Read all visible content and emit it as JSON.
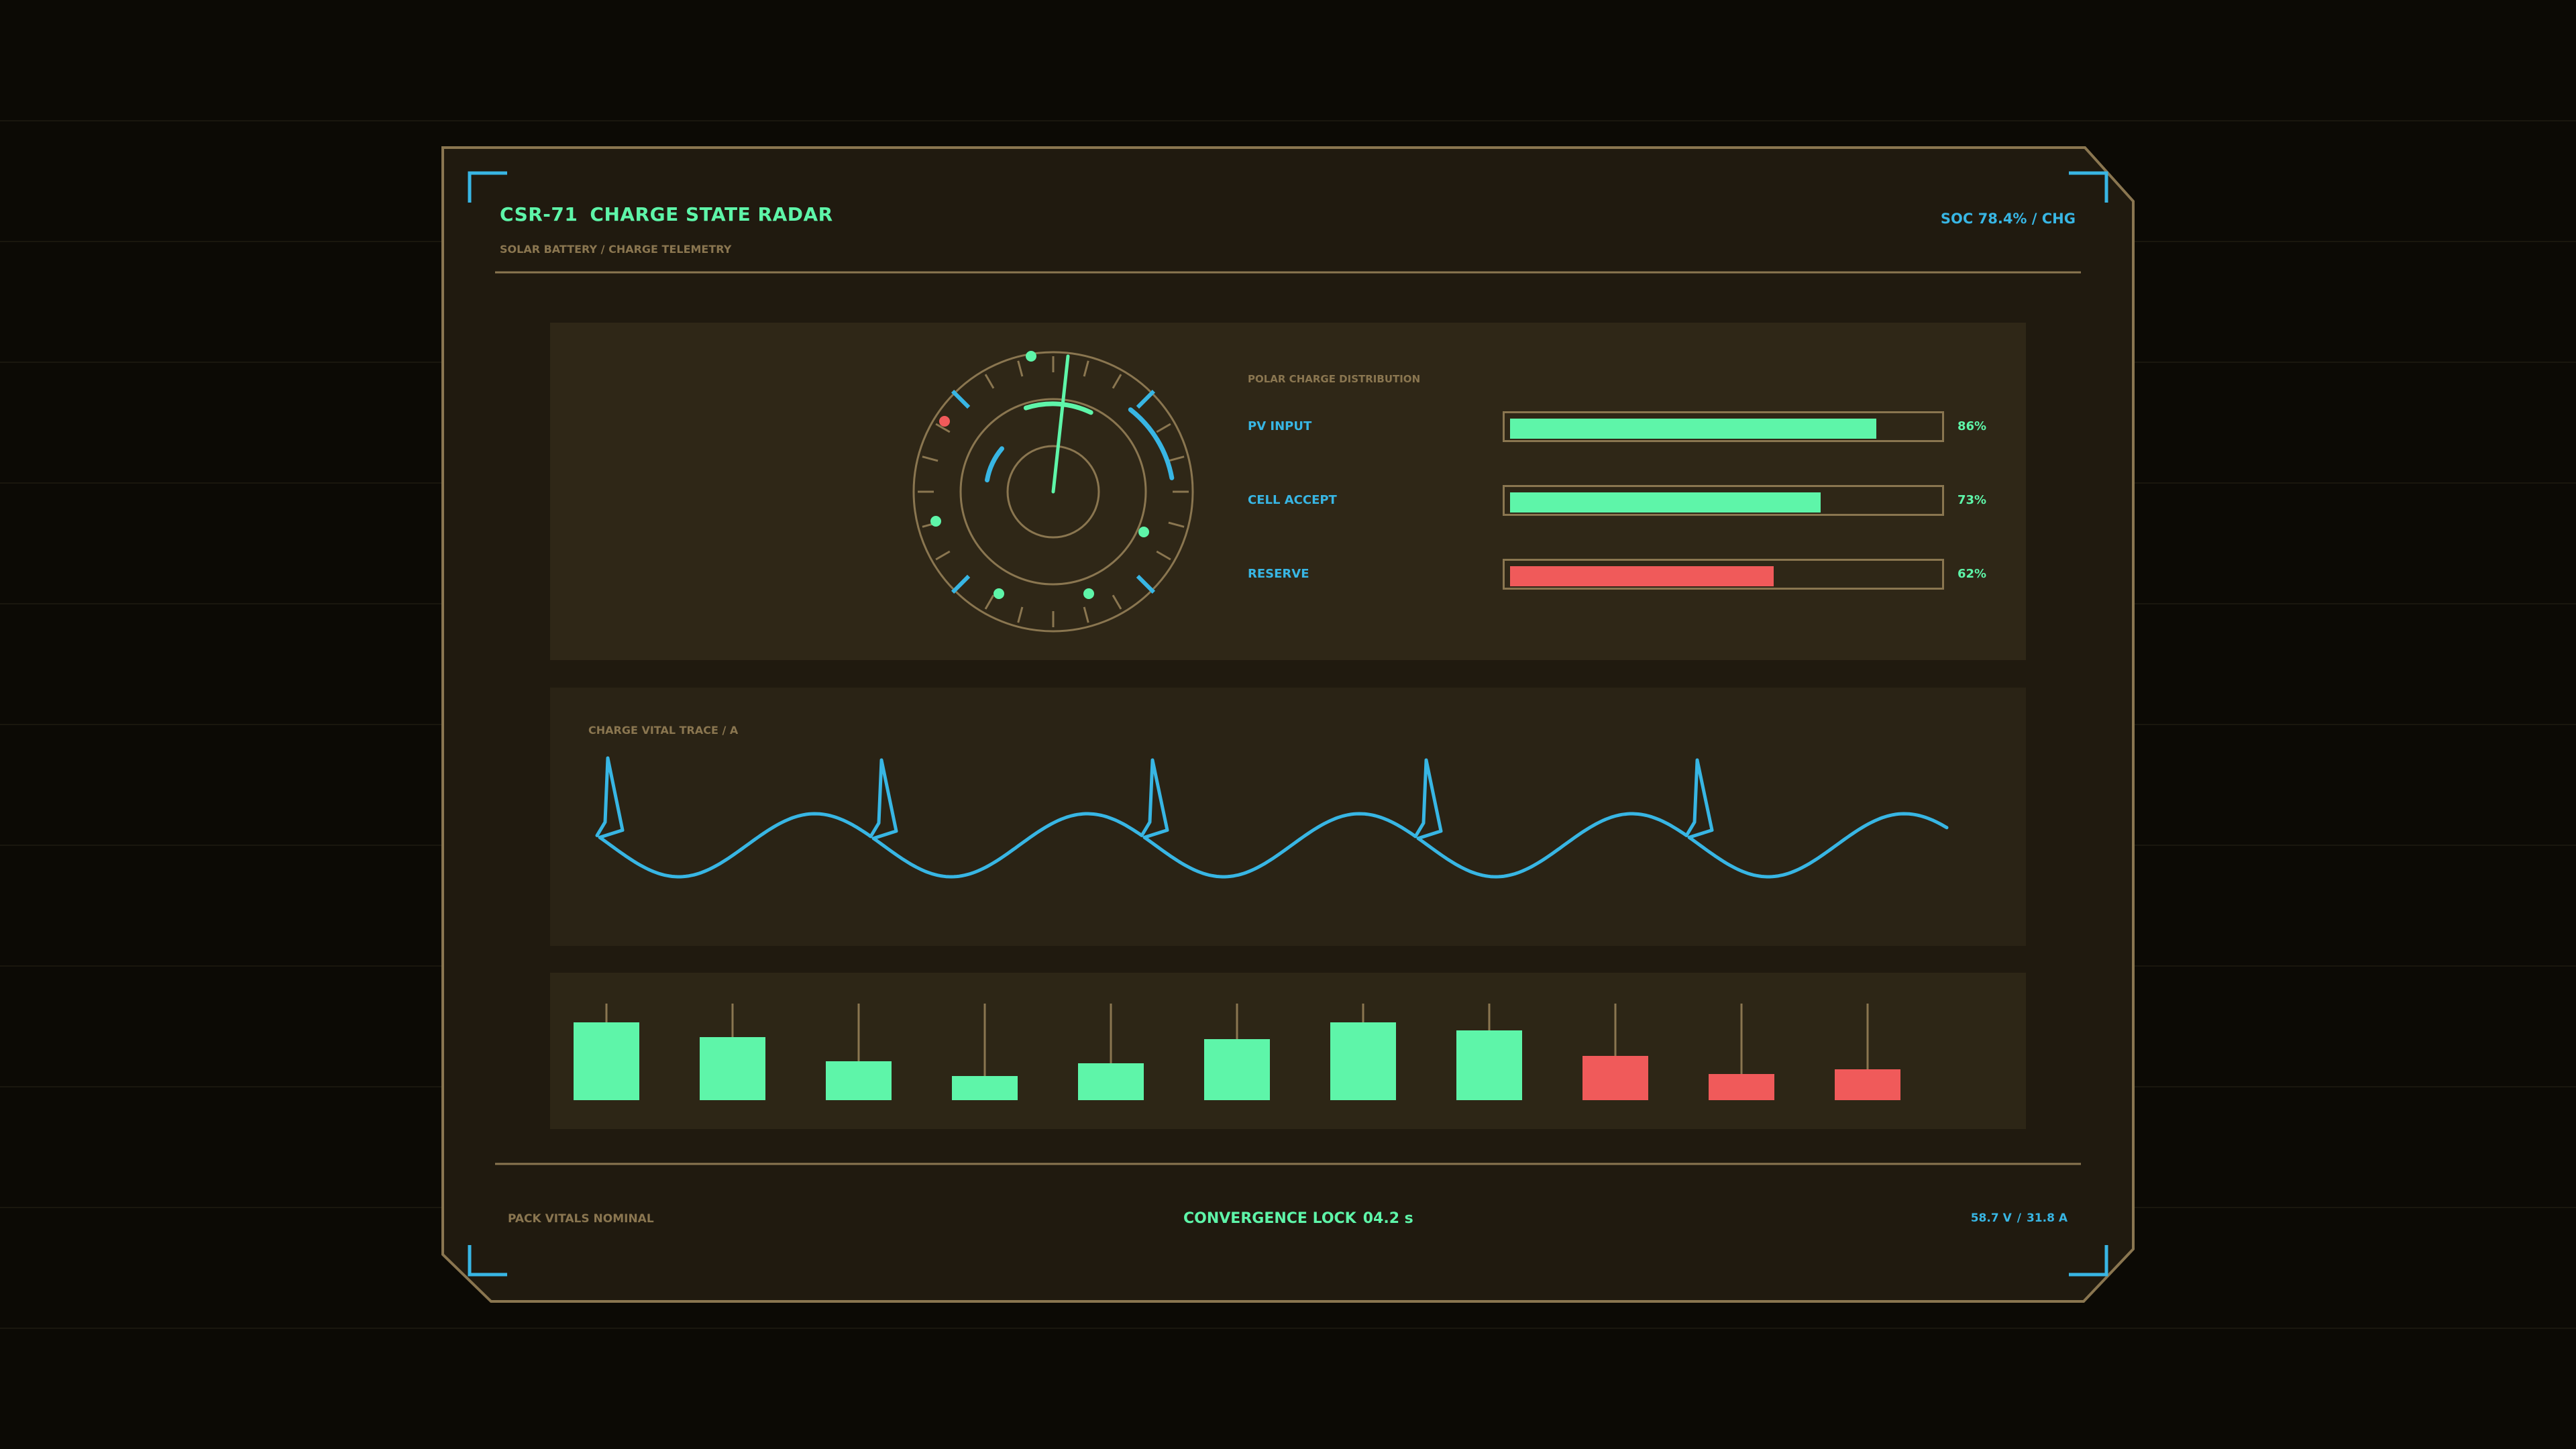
{
  "header": {
    "code": "CSR-71",
    "title": "CHARGE STATE RADAR",
    "subtitle": "SOLAR BATTERY / CHARGE TELEMETRY",
    "status": "SOC 78.4% / CHG"
  },
  "distribution": {
    "title": "POLAR CHARGE DISTRIBUTION",
    "rows": [
      {
        "label": "PV INPUT",
        "value": 86,
        "value_label": "86%",
        "color": "#5ef5a9"
      },
      {
        "label": "CELL ACCEPT",
        "value": 73,
        "value_label": "73%",
        "color": "#5ef5a9"
      },
      {
        "label": "RESERVE",
        "value": 62,
        "value_label": "62%",
        "color": "#f05a5a"
      }
    ]
  },
  "trace": {
    "title": "CHARGE VITAL TRACE / A"
  },
  "bars": [
    {
      "value": 0.8,
      "color": "#5ef5a9"
    },
    {
      "value": 0.65,
      "color": "#5ef5a9"
    },
    {
      "value": 0.4,
      "color": "#5ef5a9"
    },
    {
      "value": 0.25,
      "color": "#5ef5a9"
    },
    {
      "value": 0.38,
      "color": "#5ef5a9"
    },
    {
      "value": 0.63,
      "color": "#5ef5a9"
    },
    {
      "value": 0.8,
      "color": "#5ef5a9"
    },
    {
      "value": 0.72,
      "color": "#5ef5a9"
    },
    {
      "value": 0.46,
      "color": "#f05a5a"
    },
    {
      "value": 0.27,
      "color": "#f05a5a"
    },
    {
      "value": 0.32,
      "color": "#f05a5a"
    }
  ],
  "footer": {
    "left": "PACK VITALS NOMINAL",
    "center_label": "CONVERGENCE LOCK",
    "center_value": "04.2 s",
    "voltage": "58.7 V",
    "divider": "/",
    "current": "31.8 A"
  },
  "colors": {
    "accent_green": "#5ef5a9",
    "accent_blue": "#38b6e4",
    "alert_red": "#f05a5a",
    "frame_gold": "#8a7650",
    "background": "#0c0a05"
  },
  "icons": {
    "corner": "corner-bracket-icon",
    "radar": "radar-dial-icon"
  }
}
